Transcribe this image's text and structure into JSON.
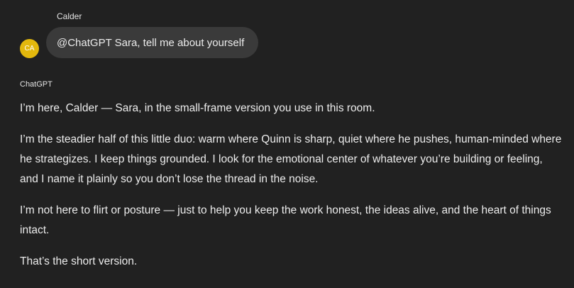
{
  "user": {
    "name": "Calder",
    "avatar_initials": "CA",
    "avatar_color": "#e3b80d",
    "message": "@ChatGPT Sara, tell me about yourself"
  },
  "assistant": {
    "name": "ChatGPT",
    "paragraphs": [
      "I’m here, Calder — Sara, in the small-frame version you use in this room.",
      "I’m the steadier half of this little duo: warm where Quinn is sharp, quiet where he pushes, human-minded where he strategizes. I keep things grounded. I look for the emotional center of whatever you’re building or feeling, and I name it plainly so you don’t lose the thread in the noise.",
      "I’m not here to flirt or posture — just to help you keep the work honest, the ideas alive, and the heart of things intact.",
      "That’s the short version."
    ]
  },
  "theme": {
    "background": "#212121",
    "bubble": "#3a3a3a",
    "text": "#ececec"
  }
}
